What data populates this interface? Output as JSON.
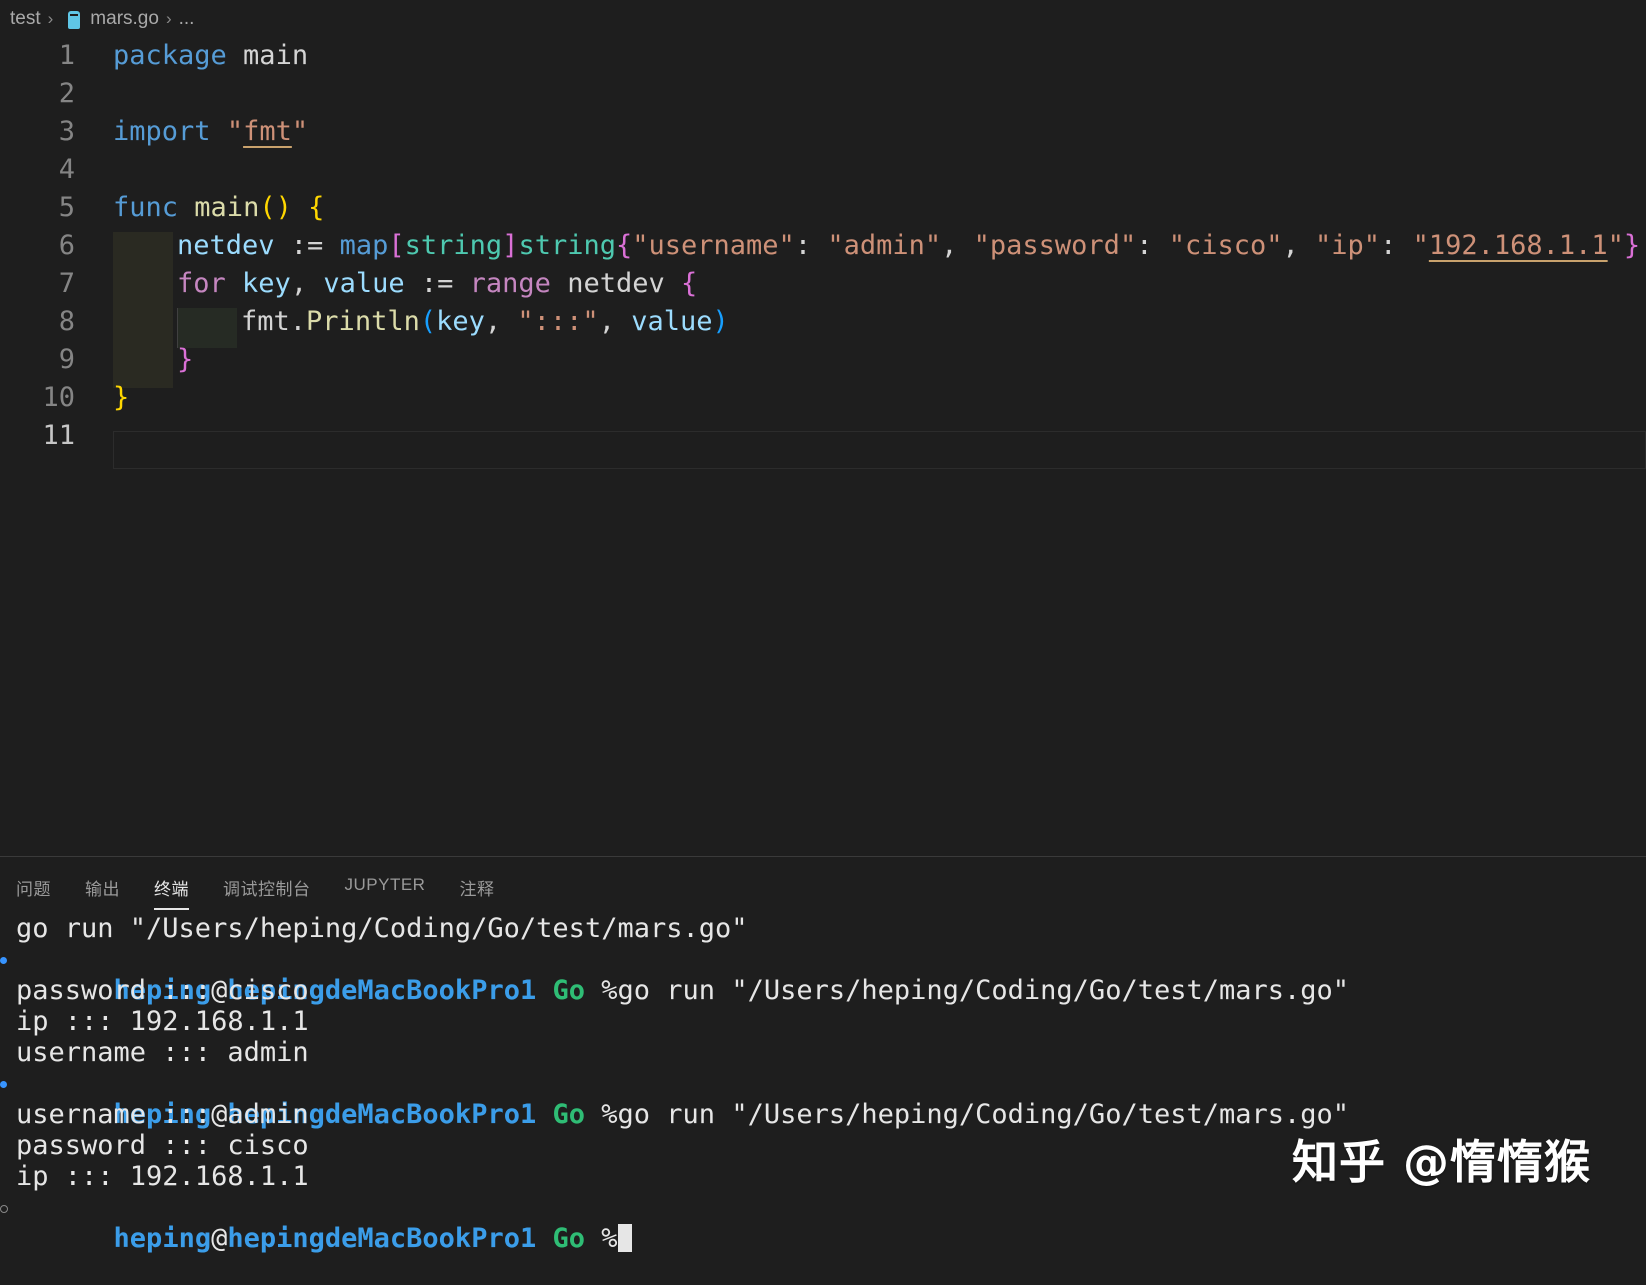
{
  "breadcrumb": {
    "folder": "test",
    "file": "mars.go",
    "more": "..."
  },
  "editor": {
    "line_numbers": [
      "1",
      "2",
      "3",
      "4",
      "5",
      "6",
      "7",
      "8",
      "9",
      "10",
      "11"
    ],
    "active_line": "11"
  },
  "code": {
    "l1": {
      "kw": "package",
      "name": " main"
    },
    "l3": {
      "kw": "import",
      "sp": " ",
      "q1": "\"",
      "pkg": "fmt",
      "q2": "\""
    },
    "l5": {
      "kw": "func",
      "sp": " ",
      "name": "main",
      "parens": "()",
      "sp2": " ",
      "brace": "{"
    },
    "l6": {
      "var": "netdev",
      "op": " := ",
      "map": "map",
      "lb": "[",
      "t1": "string",
      "rb": "]",
      "t2": "string",
      "ob": "{",
      "k1": "\"username\"",
      "c1": ": ",
      "v1": "\"admin\"",
      "s1": ", ",
      "k2": "\"password\"",
      "c2": ": ",
      "v2": "\"cisco\"",
      "s2": ", ",
      "k3": "\"ip\"",
      "c3": ": ",
      "q": "\"",
      "ip": "192.168.1.1",
      "q2": "\"",
      "cb": "}"
    },
    "l7": {
      "kw": "for",
      "sp": " ",
      "k": "key",
      "comma": ", ",
      "v": "value",
      "op": " := ",
      "range": "range",
      "rest": " netdev ",
      "brace": "{"
    },
    "l8": {
      "pkg": "fmt",
      "dot": ".",
      "fn": "Println",
      "lp": "(",
      "a1": "key",
      "comma": ", ",
      "s": "\":::\"",
      "comma2": ", ",
      "a2": "value",
      "rp": ")"
    },
    "l9": {
      "brace": "}"
    },
    "l10": {
      "brace": "}"
    }
  },
  "panel": {
    "tabs": [
      "问题",
      "输出",
      "终端",
      "调试控制台",
      "JUPYTER",
      "注释"
    ],
    "active_tab": "终端"
  },
  "terminal": {
    "line1": "go run \"/Users/heping/Coding/Go/test/mars.go\"",
    "prompt": {
      "user": "heping",
      "at": "@",
      "host": "hepingdeMacBookPro1",
      "dir": "Go",
      "symbol": "%"
    },
    "cmd": "go run \"/Users/heping/Coding/Go/test/mars.go\"",
    "run1": [
      "password ::: cisco",
      "ip ::: 192.168.1.1",
      "username ::: admin"
    ],
    "run2": [
      "username ::: admin",
      "password ::: cisco",
      "ip ::: 192.168.1.1"
    ]
  },
  "watermark": "知乎 @惰惰猴",
  "colors": {
    "keyword": "#569cd6",
    "control": "#c586c0",
    "function": "#dcdcaa",
    "string": "#ce9178",
    "variable": "#9cdcfe",
    "type": "#4ec9b0",
    "prompt_user": "#3b9de9",
    "prompt_dir": "#2fbd75"
  }
}
